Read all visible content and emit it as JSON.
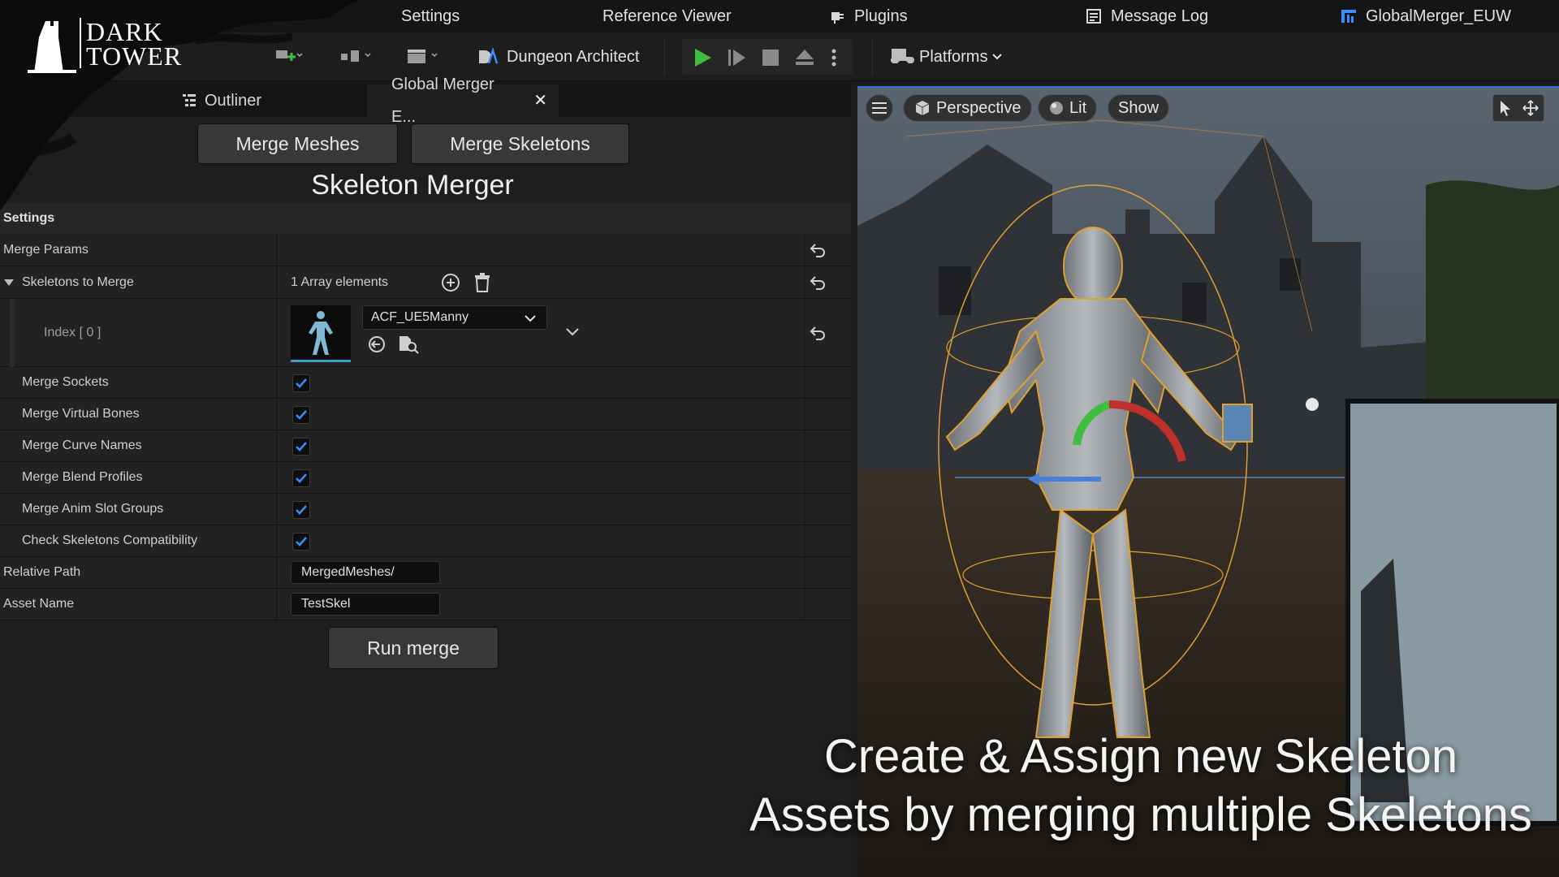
{
  "brand": {
    "logo_line1": "DARK",
    "logo_line2": "TOWER"
  },
  "menubar": {
    "settings": "Settings",
    "reference_viewer": "Reference Viewer",
    "plugins": "Plugins",
    "message_log": "Message Log",
    "project": "GlobalMerger_EUW"
  },
  "toolbar": {
    "dungeon_architect": "Dungeon Architect",
    "platforms": "Platforms"
  },
  "tabs": [
    {
      "label": "Outliner"
    },
    {
      "label": "Global Merger E..."
    }
  ],
  "mode_buttons": {
    "merge_meshes": "Merge Meshes",
    "merge_skeletons": "Merge Skeletons"
  },
  "panel_title": "Skeleton Merger",
  "settings": {
    "header": "Settings",
    "merge_params": "Merge Params",
    "skeletons_to_merge": "Skeletons to Merge",
    "array_count": "1 Array elements",
    "index_label": "Index [ 0 ]",
    "skeleton_asset": "ACF_UE5Manny",
    "options": [
      {
        "label": "Merge Sockets",
        "checked": true
      },
      {
        "label": "Merge Virtual Bones",
        "checked": true
      },
      {
        "label": "Merge Curve Names",
        "checked": true
      },
      {
        "label": "Merge Blend Profiles",
        "checked": true
      },
      {
        "label": "Merge Anim Slot Groups",
        "checked": true
      },
      {
        "label": "Check Skeletons Compatibility",
        "checked": true
      }
    ],
    "relative_path_label": "Relative Path",
    "relative_path_value": "MergedMeshes/",
    "asset_name_label": "Asset Name",
    "asset_name_value": "TestSkel",
    "run_button": "Run merge"
  },
  "viewport": {
    "perspective": "Perspective",
    "lit": "Lit",
    "show": "Show"
  },
  "caption": {
    "line1": "Create & Assign new Skeleton",
    "line2": "Assets by merging multiple Skeletons"
  },
  "colors": {
    "accent_blue": "#2b6fd6",
    "play_green": "#3fbf3f",
    "check_blue": "#3a8dff"
  }
}
